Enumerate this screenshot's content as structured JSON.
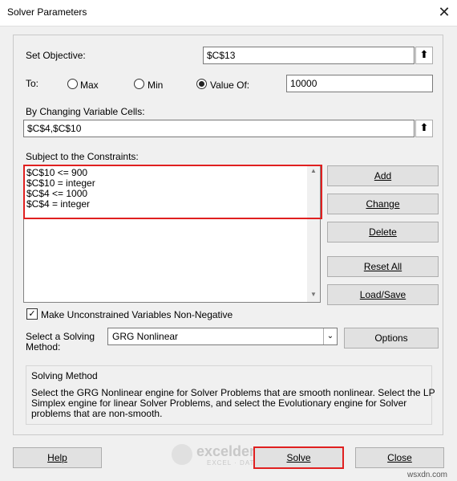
{
  "window": {
    "title": "Solver Parameters",
    "close_glyph": "✕"
  },
  "objective": {
    "label": "Set Objective:",
    "value": "$C$13"
  },
  "to": {
    "label": "To:",
    "options": [
      {
        "label": "Max",
        "selected": false
      },
      {
        "label": "Min",
        "selected": false
      },
      {
        "label": "Value Of:",
        "selected": true
      }
    ],
    "value_of": "10000"
  },
  "changing": {
    "label": "By Changing Variable Cells:",
    "value": "$C$4,$C$10"
  },
  "constraints": {
    "label": "Subject to the Constraints:",
    "items": [
      "$C$10 <= 900",
      "$C$10 = integer",
      "$C$4 <= 1000",
      "$C$4 = integer"
    ]
  },
  "constraint_buttons": {
    "add": "Add",
    "change": "Change",
    "delete": "Delete",
    "reset_all": "Reset All",
    "load_save": "Load/Save"
  },
  "nonneg": {
    "label": "Make Unconstrained Variables Non-Negative",
    "checked": true
  },
  "method": {
    "label_line1": "Select a Solving",
    "label_line2": "Method:",
    "value": "GRG Nonlinear",
    "options_button": "Options"
  },
  "solving_method": {
    "heading": "Solving Method",
    "line1": "Select the GRG Nonlinear engine for Solver Problems that are smooth nonlinear. Select the LP",
    "line2": "Simplex engine for linear Solver Problems, and select the Evolutionary engine for Solver",
    "line3": "problems that are non-smooth."
  },
  "footer": {
    "help": "Help",
    "solve": "Solve",
    "close": "Close"
  },
  "watermark": {
    "name": "exceldemy",
    "tagline": "EXCEL · DATA · BI",
    "site": "wsxdn.com"
  },
  "colors": {
    "highlight": "#e02020",
    "dialog_bg": "#f0f0f0",
    "button_bg": "#e1e1e1"
  }
}
